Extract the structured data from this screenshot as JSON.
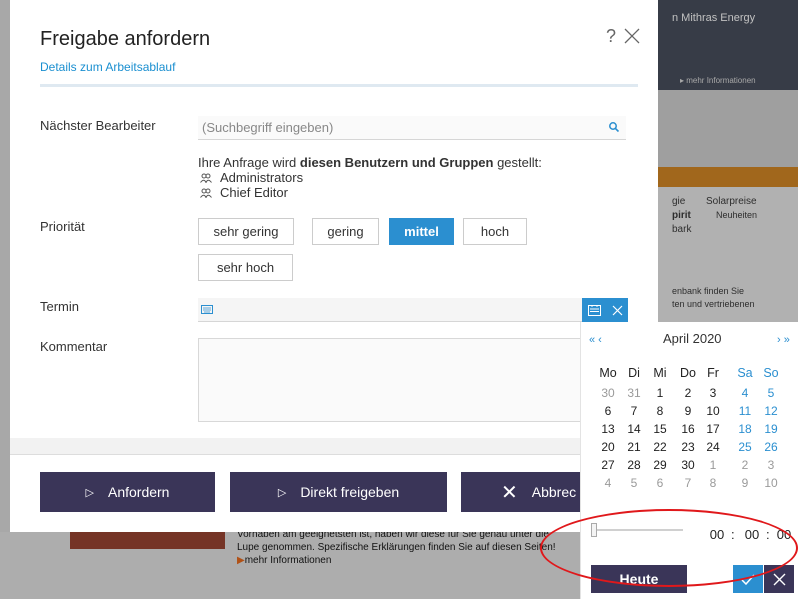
{
  "background": {
    "hero_title": "n Mithras Energy",
    "hero_more": "▸ mehr Informationen",
    "sidebar_texts": [
      "gie",
      "Solarpreise",
      "pirit",
      "Neuheiten",
      "bark",
      "enbank finden Sie",
      "ten und vertriebenen"
    ],
    "bottom_text": "Vorhaben am geeignetsten ist, haben wir diese für Sie genau unter die Lupe genommen. Spezifische Erklärungen finden Sie auf diesen Seiten!",
    "bottom_more": "mehr Informationen"
  },
  "dialog": {
    "title": "Freigabe anfordern",
    "help": "?",
    "section_tab": "Details zum Arbeitsablauf",
    "next_editor_label": "Nächster Bearbeiter",
    "search_placeholder": "(Suchbegriff eingeben)",
    "info_prefix": "Ihre Anfrage wird ",
    "info_bold": "diesen Benutzern und Gruppen",
    "info_suffix": " gestellt:",
    "groups": [
      "Administrators",
      "Chief Editor"
    ],
    "priority_label": "Priorität",
    "priorities": [
      "sehr gering",
      "gering",
      "mittel",
      "hoch",
      "sehr hoch"
    ],
    "priority_selected": "mittel",
    "deadline_label": "Termin",
    "comment_label": "Kommentar",
    "buttons": {
      "request": "Anfordern",
      "approve_direct": "Direkt freigeben",
      "cancel": "Abbrec"
    }
  },
  "calendar": {
    "nav_left": "« ‹",
    "nav_right": "› »",
    "month": "April 2020",
    "weekdays": [
      "Mo",
      "Di",
      "Mi",
      "Do",
      "Fr",
      "Sa",
      "So"
    ],
    "weeks": [
      [
        "30",
        "31",
        "1",
        "2",
        "3",
        "4",
        "5"
      ],
      [
        "6",
        "7",
        "8",
        "9",
        "10",
        "11",
        "12"
      ],
      [
        "13",
        "14",
        "15",
        "16",
        "17",
        "18",
        "19"
      ],
      [
        "20",
        "21",
        "22",
        "23",
        "24",
        "25",
        "26"
      ],
      [
        "27",
        "28",
        "29",
        "30",
        "1",
        "2",
        "3"
      ],
      [
        "4",
        "5",
        "6",
        "7",
        "8",
        "9",
        "10"
      ]
    ],
    "time_hh": "00",
    "time_mm": "00",
    "time_ss": "00",
    "today_button": "Heute",
    "colors": {
      "weekend": "#2b8fd0",
      "outside_month": "#9a9a9a",
      "accent": "#2b8fd0",
      "dark": "#3a3558"
    }
  }
}
